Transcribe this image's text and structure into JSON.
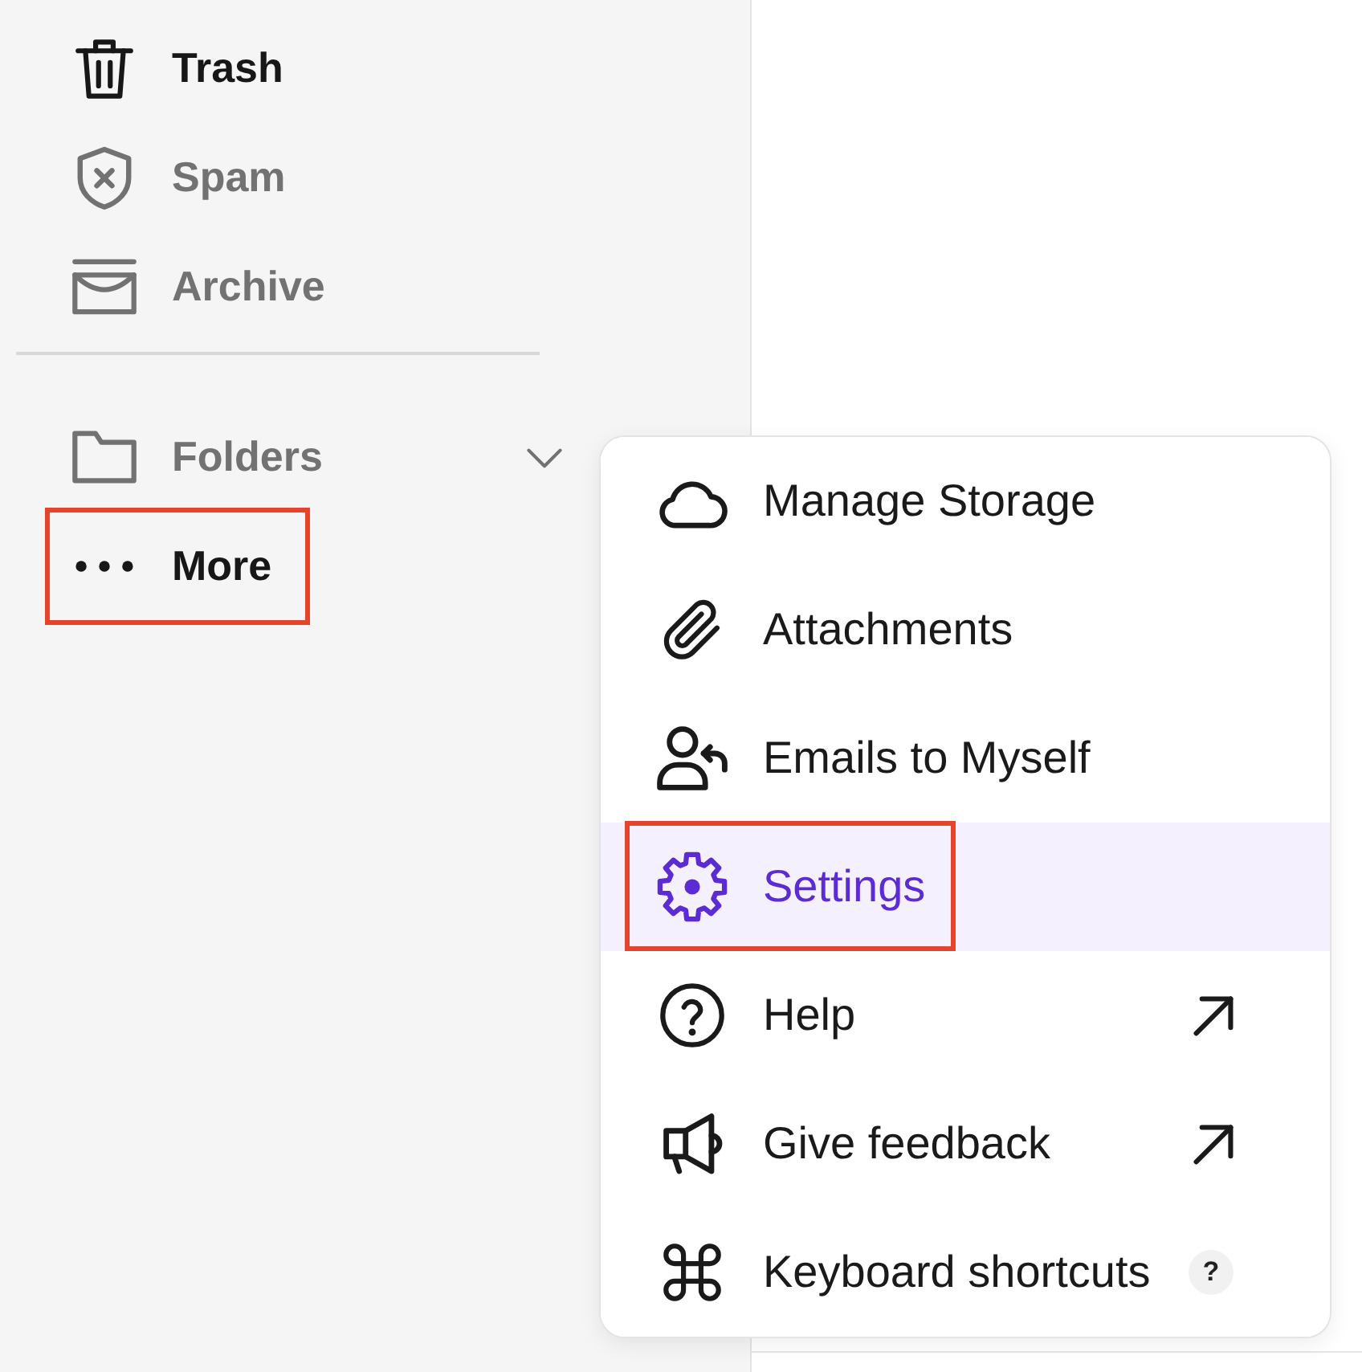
{
  "sidebar": {
    "sections": [
      {
        "items": [
          {
            "label": "Trash",
            "muted": false,
            "outlined": false
          },
          {
            "label": "Spam",
            "muted": true,
            "outlined": false
          },
          {
            "label": "Archive",
            "muted": true,
            "outlined": false
          }
        ]
      },
      {
        "items": [
          {
            "label": "Folders",
            "muted": true,
            "outlined": false,
            "expanded": false
          },
          {
            "label": "More",
            "muted": false,
            "outlined": true
          }
        ]
      }
    ]
  },
  "menu": {
    "items": [
      {
        "label": "Manage Storage",
        "selected": false,
        "outlined": false,
        "external": false
      },
      {
        "label": "Attachments",
        "selected": false,
        "outlined": false,
        "external": false
      },
      {
        "label": "Emails to Myself",
        "selected": false,
        "outlined": false,
        "external": false
      },
      {
        "label": "Settings",
        "selected": true,
        "outlined": true,
        "external": false
      },
      {
        "label": "Help",
        "selected": false,
        "outlined": false,
        "external": true
      },
      {
        "label": "Give feedback",
        "selected": false,
        "outlined": false,
        "external": true
      },
      {
        "label": "Keyboard shortcuts",
        "selected": false,
        "outlined": false,
        "external": false,
        "hint": "?"
      }
    ]
  }
}
